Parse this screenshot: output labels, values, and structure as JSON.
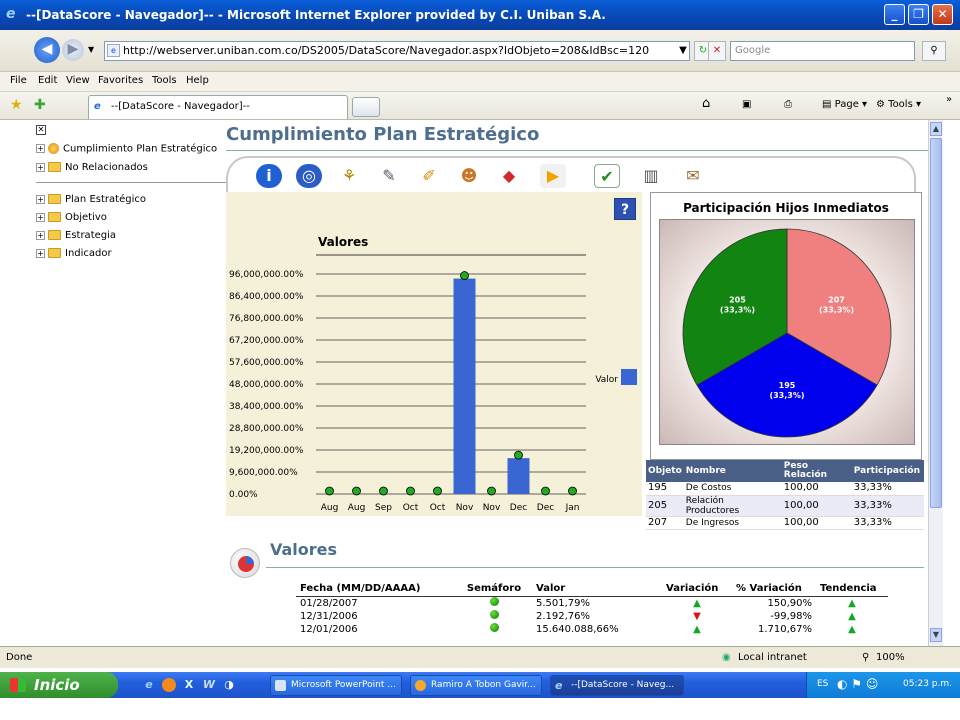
{
  "window": {
    "title": "--[DataScore - Navegador]-- - Microsoft Internet Explorer provided by C.I. Uniban S.A."
  },
  "browser": {
    "address": "http://webserver.uniban.com.co/DS2005/DataScore/Navegador.aspx?IdObjeto=208&IdBsc=120",
    "search_placeholder": "Google",
    "menu": [
      "File",
      "Edit",
      "View",
      "Favorites",
      "Tools",
      "Help"
    ],
    "tab_title": "--[DataScore - Navegador]--",
    "toolbar_right": {
      "page": "Page",
      "tools": "Tools"
    },
    "status": "Done",
    "zone": "Local intranet",
    "zoom": "100%"
  },
  "sidebar": {
    "top_items": [
      "Cumplimiento Plan Estratégico",
      "No Relacionados"
    ],
    "items": [
      "Plan Estratégico",
      "Objetivo",
      "Estrategia",
      "Indicador"
    ]
  },
  "page": {
    "title": "Cumplimiento Plan Estratégico",
    "help": "?",
    "valores_title": "Valores"
  },
  "toolbar_icons": [
    "info-icon",
    "search-icon",
    "users-icon",
    "edit-doc-icon",
    "pencil-icon",
    "people-icon",
    "cube-icon",
    "bell-icon",
    "check-list-icon",
    "card-icon",
    "document-icon"
  ],
  "chart_data": [
    {
      "type": "bar",
      "title": "Valores",
      "categories": [
        "Aug",
        "Aug",
        "Sep",
        "Oct",
        "Oct",
        "Nov",
        "Nov",
        "Dec",
        "Dec",
        "Jan"
      ],
      "yticks": [
        "96,000,000.00%",
        "86,400,000.00%",
        "76,800,000.00%",
        "67,200,000.00%",
        "57,600,000.00%",
        "48,000,000.00%",
        "38,400,000.00%",
        "28,800,000.00%",
        "19,200,000.00%",
        "9,600,000.00%",
        "0.00%"
      ],
      "ylim": [
        0,
        96000000
      ],
      "series": [
        {
          "name": "Valor",
          "color": "#3a66d4",
          "values": [
            0,
            0,
            0,
            0,
            0,
            94000000,
            0,
            15640088.66,
            0,
            0
          ]
        }
      ]
    },
    {
      "type": "pie",
      "title": "Participación Hijos Inmediatos",
      "slices": [
        {
          "label": "207",
          "pct": "(33,3%)",
          "value": 33.3,
          "color": "#f08080"
        },
        {
          "label": "195",
          "pct": "(33,3%)",
          "value": 33.3,
          "color": "#0000ee"
        },
        {
          "label": "205",
          "pct": "(33,3%)",
          "value": 33.3,
          "color": "#128412"
        }
      ]
    }
  ],
  "participation_table": {
    "headers": [
      "Objeto",
      "Nombre",
      "Peso Relación",
      "Participación"
    ],
    "rows": [
      [
        "195",
        "De Costos",
        "100,00",
        "33,33%"
      ],
      [
        "205",
        "Relación Productores",
        "100,00",
        "33,33%"
      ],
      [
        "207",
        "De Ingresos",
        "100,00",
        "33,33%"
      ]
    ]
  },
  "valores_table": {
    "headers": [
      "Fecha (MM/DD/AAAA)",
      "Semáforo",
      "Valor",
      "Variación",
      "% Variación",
      "Tendencia"
    ],
    "rows": [
      {
        "fecha": "01/28/2007",
        "valor": "5.501,79%",
        "variacion": "up",
        "pct": "150,90%",
        "tendencia": "up"
      },
      {
        "fecha": "12/31/2006",
        "valor": "2.192,76%",
        "variacion": "down",
        "pct": "-99,98%",
        "tendencia": "up"
      },
      {
        "fecha": "12/01/2006",
        "valor": "15.640.088,66%",
        "variacion": "up",
        "pct": "1.710,67%",
        "tendencia": "up"
      }
    ]
  },
  "taskbar": {
    "start": "Inicio",
    "tasks": [
      "Microsoft PowerPoint ...",
      "Ramiro A Tobon Gavir...",
      "--[DataScore - Naveg..."
    ],
    "lang": "ES",
    "clock": "05:23 p.m."
  }
}
